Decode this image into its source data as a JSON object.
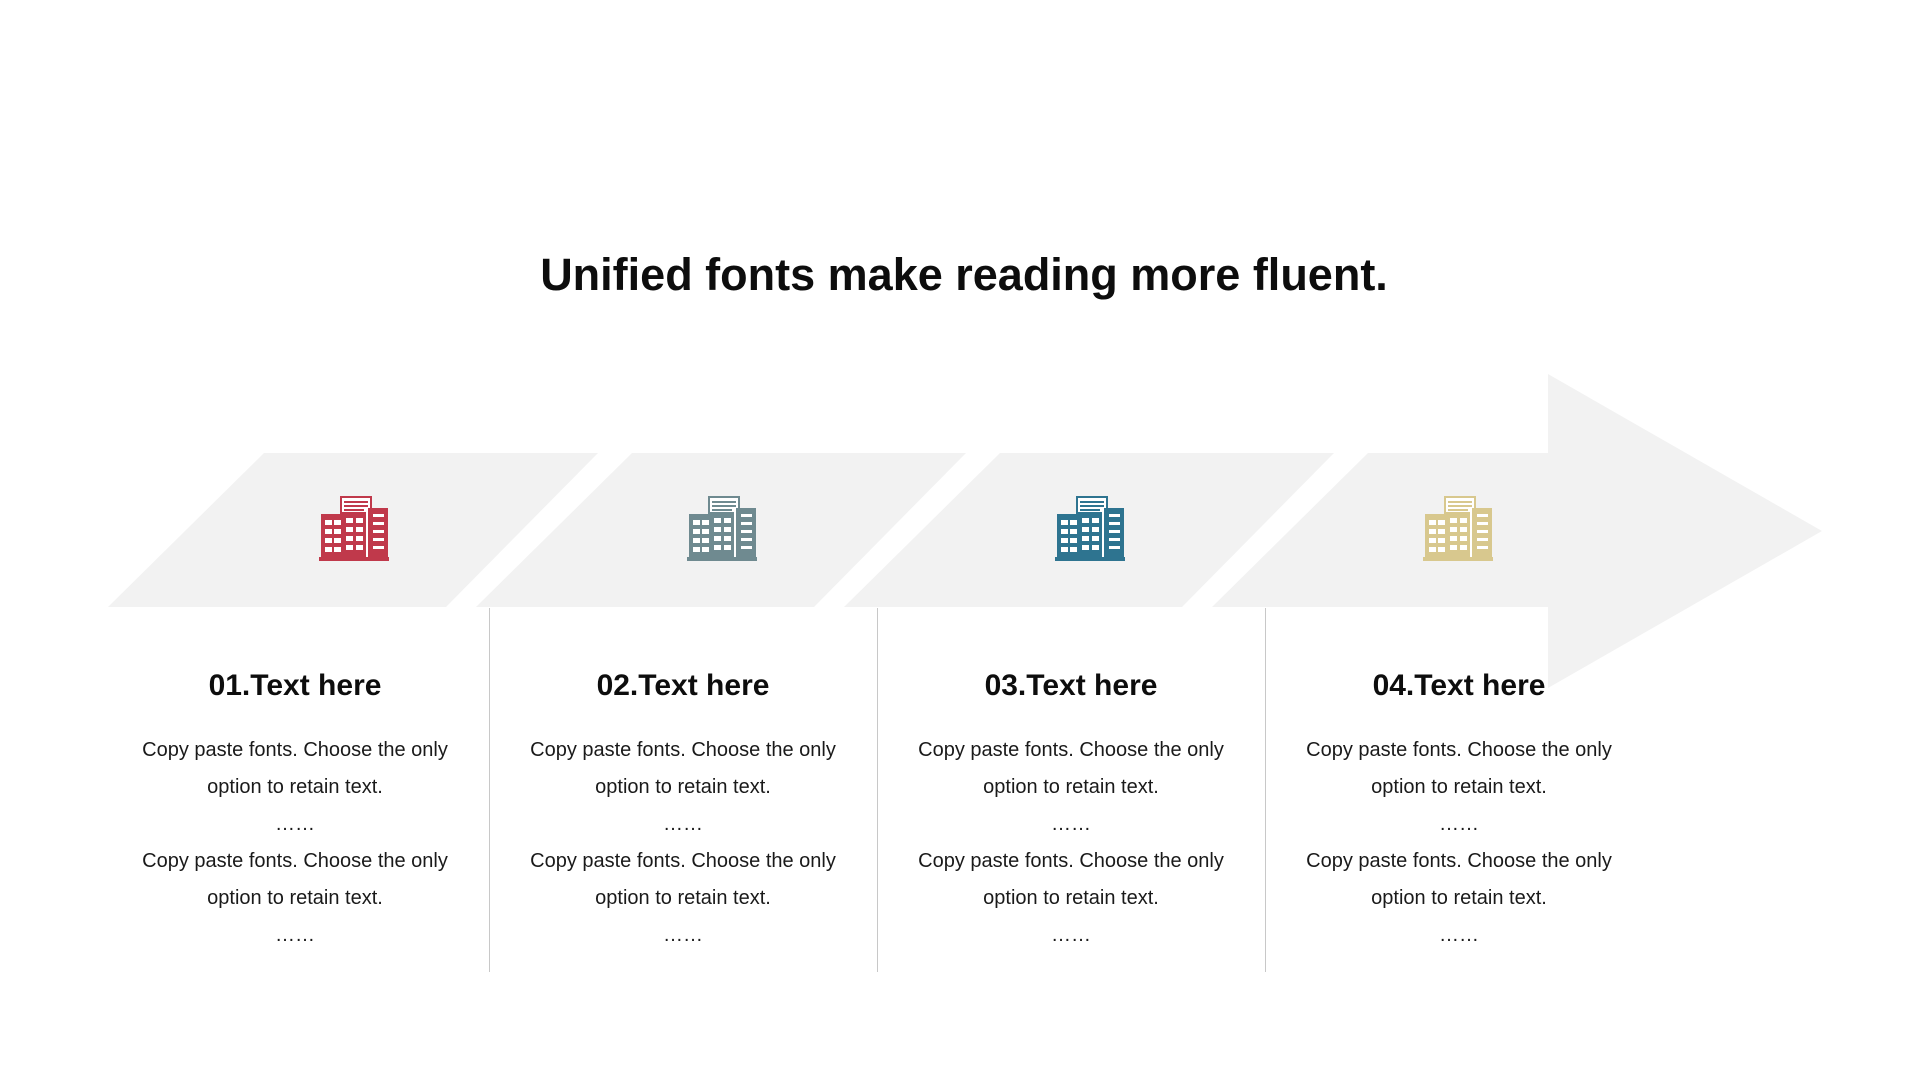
{
  "title": "Unified fonts make reading more fluent.",
  "colors": {
    "banner": "#f2f2f2",
    "divider": "#c8c8c8"
  },
  "steps": [
    {
      "heading": "01.Text here",
      "icon": "building-icon",
      "icon_color": "#c0394b",
      "lines": [
        "Copy paste fonts. Choose the only",
        "option to retain text.",
        "……",
        "Copy paste fonts. Choose the only",
        "option to retain text.",
        "……"
      ]
    },
    {
      "heading": "02.Text here",
      "icon": "building-icon",
      "icon_color": "#6f8a90",
      "lines": [
        "Copy paste fonts. Choose the only",
        "option to retain text.",
        "……",
        "Copy paste fonts. Choose the only",
        "option to retain text.",
        "……"
      ]
    },
    {
      "heading": "03.Text here",
      "icon": "building-icon",
      "icon_color": "#2e7490",
      "lines": [
        "Copy paste fonts. Choose the only",
        "option to retain text.",
        "……",
        "Copy paste fonts. Choose the only",
        "option to retain text.",
        "……"
      ]
    },
    {
      "heading": "04.Text here",
      "icon": "building-icon",
      "icon_color": "#d8c88e",
      "lines": [
        "Copy paste fonts. Choose the only",
        "option to retain text.",
        "……",
        "Copy paste fonts. Choose the only",
        "option to retain text.",
        "……"
      ]
    }
  ]
}
